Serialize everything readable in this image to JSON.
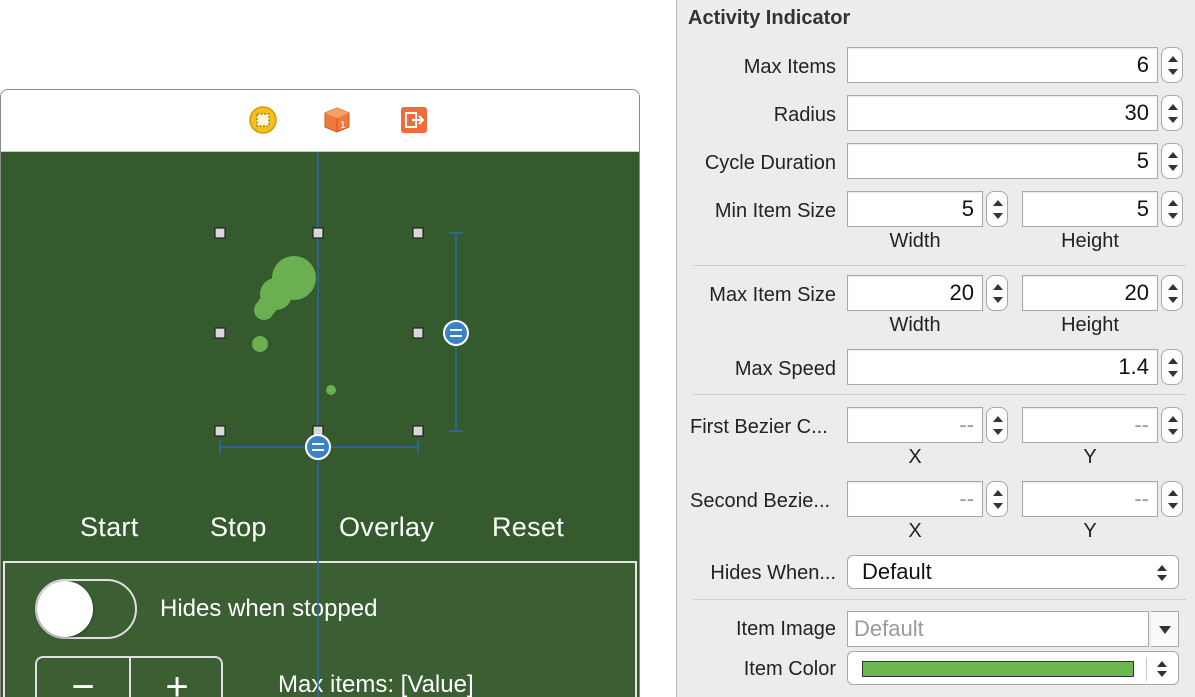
{
  "scene": {
    "buttons": [
      "Start",
      "Stop",
      "Overlay",
      "Reset"
    ],
    "hides_when_stopped_label": "Hides when stopped",
    "stepper": {
      "minus": "−",
      "plus": "+"
    },
    "max_items_label": "Max items: [Value]",
    "toggle_on": false,
    "dock_icons": [
      "view-controller-icon",
      "first-responder-icon",
      "exit-icon"
    ],
    "colors": {
      "view_background": "#345a2e",
      "dots": "#6aaf50",
      "guide": "#2a6aa8"
    }
  },
  "inspector": {
    "title": "Activity Indicator",
    "rows": {
      "max_items": {
        "label": "Max Items",
        "value": "6"
      },
      "radius": {
        "label": "Radius",
        "value": "30"
      },
      "cycle_duration": {
        "label": "Cycle Duration",
        "value": "5"
      },
      "min_item_size": {
        "label": "Min Item Size",
        "width": "5",
        "height": "5",
        "width_label": "Width",
        "height_label": "Height"
      },
      "max_item_size": {
        "label": "Max Item Size",
        "width": "20",
        "height": "20",
        "width_label": "Width",
        "height_label": "Height"
      },
      "max_speed": {
        "label": "Max Speed",
        "value": "1.4"
      },
      "first_bezier": {
        "label": "First Bezier C...",
        "x": "--",
        "y": "--",
        "x_label": "X",
        "y_label": "Y"
      },
      "second_bezier": {
        "label": "Second Bezie...",
        "x": "--",
        "y": "--",
        "x_label": "X",
        "y_label": "Y"
      },
      "hides_when": {
        "label": "Hides When...",
        "value": "Default"
      },
      "item_image": {
        "label": "Item Image",
        "placeholder": "Default"
      },
      "item_color": {
        "label": "Item Color",
        "color": "#6ab84f"
      }
    }
  }
}
